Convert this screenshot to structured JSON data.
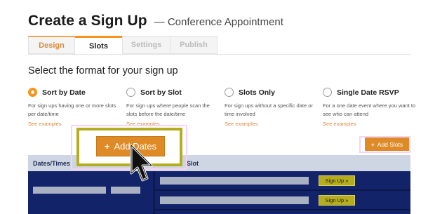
{
  "header": {
    "title": "Create a Sign Up",
    "subtitle": "— Conference Appointment"
  },
  "tabs": [
    {
      "label": "Design",
      "state": "enabled"
    },
    {
      "label": "Slots",
      "state": "active"
    },
    {
      "label": "Settings",
      "state": "disabled"
    },
    {
      "label": "Publish",
      "state": "disabled"
    }
  ],
  "format_prompt": "Select the format for your sign up",
  "options": [
    {
      "label": "Sort by Date",
      "selected": true,
      "description_1": "For sign ups having one or more slots",
      "description_2": "per date/time",
      "link": "See examples"
    },
    {
      "label": "Sort by Slot",
      "selected": false,
      "description_1": "For sign ups where people scan the",
      "description_2": "slots before the date/time",
      "link": "See examples"
    },
    {
      "label": "Slots Only",
      "selected": false,
      "description_1": "For sign ups without a specific date or",
      "description_2": "time involved",
      "link": "See examples"
    },
    {
      "label": "Single Date RSVP",
      "selected": false,
      "description_1": "For a one date event where you want to",
      "description_2": "see who can attend",
      "link": "See examples"
    }
  ],
  "buttons": {
    "add_dates": "Add Dates",
    "add_slots": "Add Slots",
    "plus_glyph": "+"
  },
  "table": {
    "col_dates": "Dates/Times",
    "col_slot": "Slot",
    "rows": [
      {
        "signup_label": "Sign Up",
        "arrow": "»"
      },
      {
        "signup_label": "Sign Up",
        "arrow": "»"
      }
    ]
  },
  "colors": {
    "accent_orange": "#f7931e",
    "button_orange": "#dd8a27",
    "highlight_olive": "#b5ad20",
    "table_navy": "#13236a",
    "table_header": "#cfd6e3"
  },
  "icons": {
    "cursor": "hand-pointer-icon",
    "plus": "plus-icon",
    "radio_checked": "radio-checked-icon",
    "radio_unchecked": "radio-unchecked-icon"
  }
}
